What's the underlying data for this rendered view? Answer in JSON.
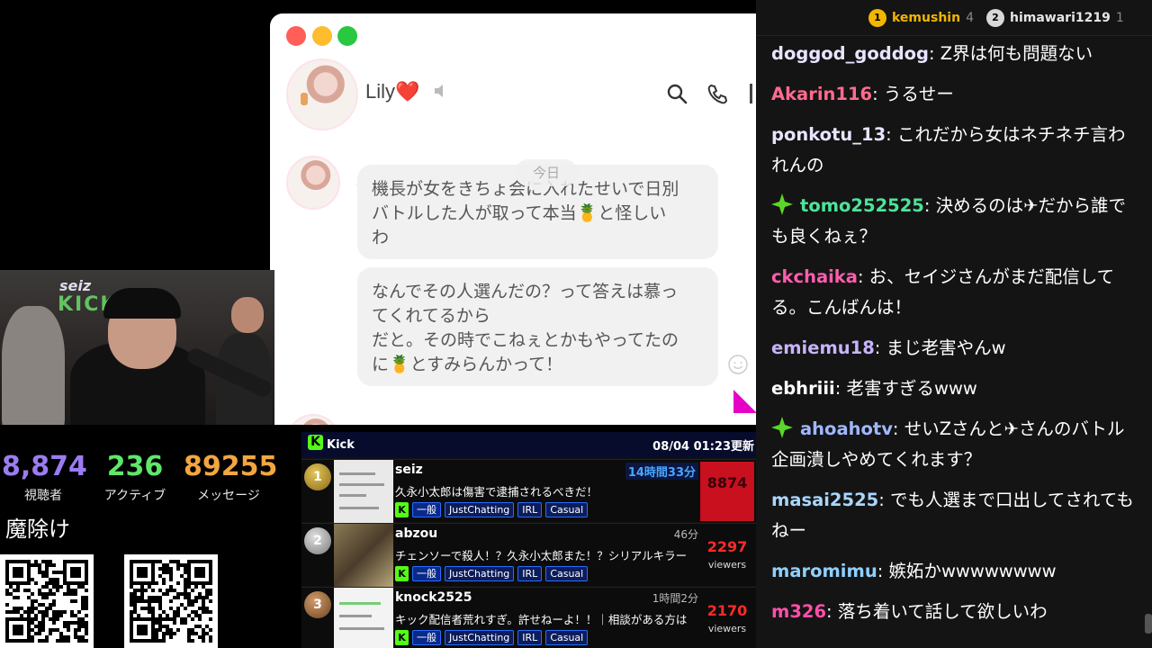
{
  "messenger": {
    "contact_name": "Lily❤️",
    "date_chip": "今日",
    "messages": [
      "機長が女をきちょ会に入れたせいで日別\nバトルした人が取って本当🍍と怪しい\nわ",
      "なんでその人選んだの？って答えは慕っ\nてくれてるから\nだと。その時でこねぇとかもやってたの\nに🍍とすみらんかって！"
    ]
  },
  "webcam": {
    "sign_top": "seiz",
    "sign_bottom": "KICK"
  },
  "stats": {
    "viewers": {
      "value": "8,874",
      "label": "視聴者",
      "color": "#9b7cf0"
    },
    "active": {
      "value": "236",
      "label": "アクティブ",
      "color": "#5ee86a"
    },
    "messages": {
      "value": "89255",
      "label": "メッセージ",
      "color": "#f3a640"
    }
  },
  "charm_text": "魔除け",
  "ranking": {
    "logo": "K",
    "title": "Kick",
    "updated": "08/04 01:23更新",
    "tag_general": "一般",
    "rows": [
      {
        "rank": "1",
        "name": "seiz",
        "duration": "14時間33分",
        "title": "久永小太郎は傷害で逮捕されるべきだ！",
        "tags": [
          "JustChatting",
          "IRL",
          "Casual"
        ],
        "viewers": "8874",
        "viewers_label": "viewers"
      },
      {
        "rank": "2",
        "name": "abzou",
        "duration": "46分",
        "title": "チェンソーで殺人！？久永小太郎また！？シリアルキラー",
        "tags": [
          "JustChatting",
          "IRL",
          "Casual"
        ],
        "viewers": "2297",
        "viewers_label": "viewers"
      },
      {
        "rank": "3",
        "name": "knock2525",
        "duration": "1時間2分",
        "title": "キック配信者荒れすぎ。許せねーよ！！｜相談がある方は",
        "tags": [
          "JustChatting",
          "IRL",
          "Casual"
        ],
        "viewers": "2170",
        "viewers_label": "viewers"
      }
    ]
  },
  "chat": {
    "leaderboard": [
      {
        "rank": "1",
        "name": "kemushin",
        "count": "4",
        "color": "#f2b600"
      },
      {
        "rank": "2",
        "name": "himawari1219",
        "count": "1",
        "color": "#d8d8d8"
      }
    ],
    "messages": [
      {
        "user": "doggod_goddog",
        "color": "#e9e4ff",
        "text": "Z界は何も問題ない",
        "badge": false
      },
      {
        "user": "Akarin116",
        "color": "#ff6b8e",
        "text": "うるせー",
        "badge": false
      },
      {
        "user": "ponkotu_13",
        "color": "#e9e4ff",
        "text": "これだから女はネチネチ言われんの",
        "badge": false
      },
      {
        "user": "tomo252525",
        "color": "#4de39a",
        "text": "決めるのは✈だから誰でも良くねぇ？",
        "badge": true
      },
      {
        "user": "ckchaika",
        "color": "#ff5dad",
        "text": "お、セイジさんがまだ配信してる。こんばんは！",
        "badge": false
      },
      {
        "user": "emiemu18",
        "color": "#c9b3ff",
        "text": "まじ老害やんw",
        "badge": false
      },
      {
        "user": "ebhriii",
        "color": "#ffffff",
        "text": "老害すぎるwww",
        "badge": false
      },
      {
        "user": "ahoahotv",
        "color": "#9fb8ff",
        "text": "せいZさんと✈さんのバトル企画潰しやめてくれます？",
        "badge": true
      },
      {
        "user": "masai2525",
        "color": "#a9d6ff",
        "text": "でも人選まで口出してされてもねー",
        "badge": false
      },
      {
        "user": "maromimu",
        "color": "#8fd0ff",
        "text": "嫉妬かwwwwwwww",
        "badge": false
      },
      {
        "user": "m326",
        "color": "#ff4fa8",
        "text": "落ち着いて話して欲しいわ",
        "badge": false
      }
    ]
  }
}
